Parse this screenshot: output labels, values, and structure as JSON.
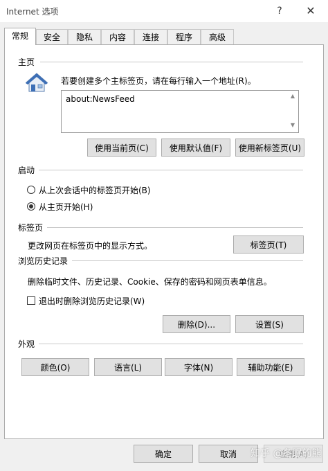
{
  "window": {
    "title": "Internet 选项",
    "help": "?",
    "close": "✕"
  },
  "tabs": [
    {
      "label": "常规",
      "active": true
    },
    {
      "label": "安全"
    },
    {
      "label": "隐私"
    },
    {
      "label": "内容"
    },
    {
      "label": "连接"
    },
    {
      "label": "程序"
    },
    {
      "label": "高级"
    }
  ],
  "home": {
    "section": "主页",
    "description": "若要创建多个主标签页，请在每行输入一个地址(R)。",
    "url": "about:NewsFeed",
    "btn_current": "使用当前页(C)",
    "btn_default": "使用默认值(F)",
    "btn_newtab": "使用新标签页(U)"
  },
  "startup": {
    "section": "启动",
    "option_last_session": "从上次会话中的标签页开始(B)",
    "option_home": "从主页开始(H)",
    "selected": "option_home"
  },
  "tabs_section": {
    "section": "标签页",
    "description": "更改网页在标签页中的显示方式。",
    "button": "标签页(T)"
  },
  "history": {
    "section": "浏览历史记录",
    "description": "删除临时文件、历史记录、Cookie、保存的密码和网页表单信息。",
    "checkbox_label": "退出时删除浏览历史记录(W)",
    "checkbox_checked": false,
    "btn_delete": "删除(D)...",
    "btn_settings": "设置(S)"
  },
  "appearance": {
    "section": "外观",
    "btn_colors": "颜色(O)",
    "btn_languages": "语言(L)",
    "btn_fonts": "字体(N)",
    "btn_accessibility": "辅助功能(E)"
  },
  "footer": {
    "ok": "确定",
    "cancel": "取消",
    "apply": "应用(A)"
  },
  "watermark": "知乎 @冬眠的熊"
}
